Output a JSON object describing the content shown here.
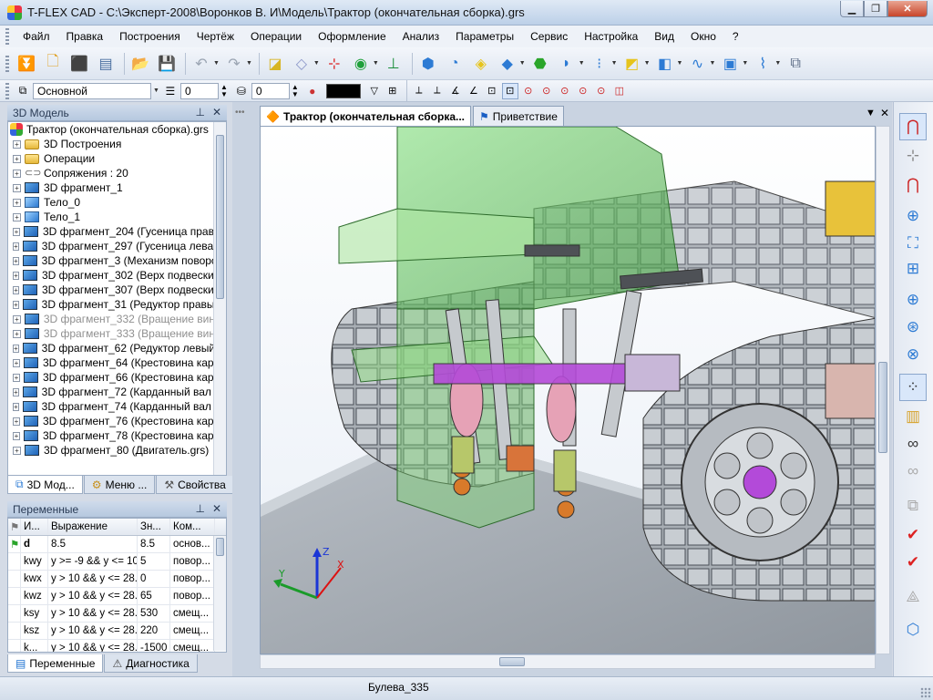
{
  "window": {
    "title": "T-FLEX CAD - C:\\Эксперт-2008\\Воронков В. И\\Модель\\Трактор (окончательная сборка).grs"
  },
  "menu": [
    "Файл",
    "Правка",
    "Построения",
    "Чертёж",
    "Операции",
    "Оформление",
    "Анализ",
    "Параметры",
    "Сервис",
    "Настройка",
    "Вид",
    "Окно",
    "?"
  ],
  "toolbar2": {
    "style_value": "Основной",
    "layer_value": "0",
    "level_value": "0",
    "color": "#000000"
  },
  "model_panel": {
    "title": "3D Модель",
    "root": "Трактор (окончательная сборка).grs",
    "items": [
      {
        "label": "3D Построения",
        "type": "folder",
        "grey": false
      },
      {
        "label": "Операции",
        "type": "folder",
        "grey": false
      },
      {
        "label": "Сопряжения : 20",
        "type": "mate",
        "grey": false
      },
      {
        "label": "3D фрагмент_1",
        "type": "fragment",
        "grey": false
      },
      {
        "label": "Тело_0",
        "type": "body",
        "grey": false
      },
      {
        "label": "Тело_1",
        "type": "body",
        "grey": false
      },
      {
        "label": "3D фрагмент_204 (Гусеница правая",
        "type": "fragment",
        "grey": false
      },
      {
        "label": "3D фрагмент_297 (Гусеница левая (",
        "type": "fragment",
        "grey": false
      },
      {
        "label": "3D фрагмент_3 (Механизм поворота",
        "type": "fragment",
        "grey": false
      },
      {
        "label": "3D фрагмент_302 (Верх подвески (с",
        "type": "fragment",
        "grey": false
      },
      {
        "label": "3D фрагмент_307 (Верх подвески (с",
        "type": "fragment",
        "grey": false
      },
      {
        "label": "3D фрагмент_31 (Редуктор правый (",
        "type": "fragment",
        "grey": false
      },
      {
        "label": "3D фрагмент_332 (Вращение винта",
        "type": "fragment",
        "grey": true
      },
      {
        "label": "3D фрагмент_333 (Вращение винта",
        "type": "fragment",
        "grey": true
      },
      {
        "label": "3D фрагмент_62 (Редуктор левый (с",
        "type": "fragment",
        "grey": false
      },
      {
        "label": "3D фрагмент_64 (Крестовина карда",
        "type": "fragment",
        "grey": false
      },
      {
        "label": "3D фрагмент_66 (Крестовина карда",
        "type": "fragment",
        "grey": false
      },
      {
        "label": "3D фрагмент_72 (Карданный вал 2.g",
        "type": "fragment",
        "grey": false
      },
      {
        "label": "3D фрагмент_74 (Карданный вал 2.g",
        "type": "fragment",
        "grey": false
      },
      {
        "label": "3D фрагмент_76 (Крестовина карда",
        "type": "fragment",
        "grey": false
      },
      {
        "label": "3D фрагмент_78 (Крестовина карда",
        "type": "fragment",
        "grey": false
      },
      {
        "label": "3D фрагмент_80 (Двигатель.grs)",
        "type": "fragment",
        "grey": false
      }
    ],
    "tabs": [
      "3D Мод...",
      "Меню ...",
      "Свойства"
    ]
  },
  "vars_panel": {
    "title": "Переменные",
    "columns": [
      "И...",
      "Выражение",
      "Зн...",
      "Ком..."
    ],
    "rows": [
      {
        "name": "d",
        "expr": "8.5",
        "value": "8.5",
        "comment": "основ..."
      },
      {
        "name": "kwy",
        "expr": "y >= -9 && y <= 10...",
        "value": "5",
        "comment": "повор..."
      },
      {
        "name": "kwx",
        "expr": "y > 10 && y <= 28....",
        "value": "0",
        "comment": "повор..."
      },
      {
        "name": "kwz",
        "expr": "y > 10 && y <= 28....",
        "value": "65",
        "comment": "повор..."
      },
      {
        "name": "ksy",
        "expr": "y > 10 && y <= 28....",
        "value": "530",
        "comment": "смещ..."
      },
      {
        "name": "ksz",
        "expr": "y > 10 && y <= 28....",
        "value": "220",
        "comment": "смещ..."
      },
      {
        "name": "k...",
        "expr": "y > 10 && y <= 28...",
        "value": "-1500",
        "comment": "смещ..."
      }
    ],
    "tabs": [
      "Переменные",
      "Диагностика"
    ]
  },
  "doc_tabs": [
    "Трактор (окончательная сборка...",
    "Приветствие"
  ],
  "axes": {
    "x": "X",
    "y": "Y",
    "z": "Z"
  },
  "status": {
    "text": "Булева_335"
  },
  "colors": {
    "accent": "#2b63c4",
    "title_bg": "#c8d8ec"
  }
}
